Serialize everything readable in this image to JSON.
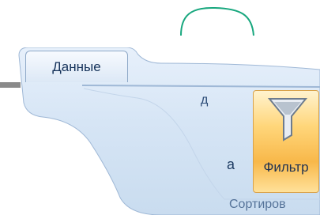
{
  "ribbon": {
    "active_tab": "Данные",
    "clipped_command_char": "а",
    "clipped_top_char": "д",
    "filter_button": {
      "label": "Фильтр",
      "icon": "funnel-icon"
    },
    "group_label": "Сортиров"
  },
  "colors": {
    "ribbon_blue": "#d5e4f4",
    "filter_highlight": "#f8b84a",
    "annotation_green": "#18a77e"
  }
}
